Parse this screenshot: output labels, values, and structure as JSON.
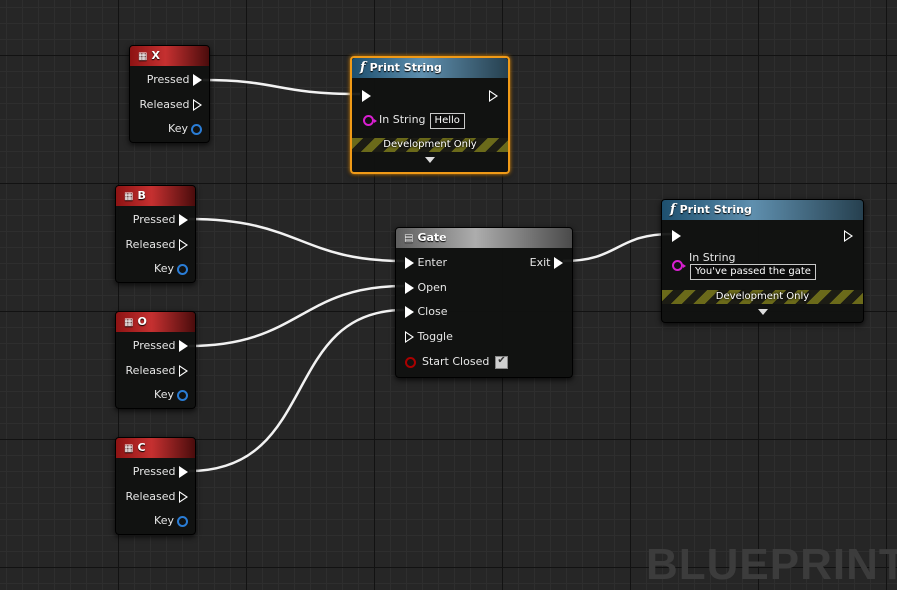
{
  "input_nodes": [
    {
      "key": "X",
      "pins": [
        "Pressed",
        "Released",
        "Key"
      ]
    },
    {
      "key": "B",
      "pins": [
        "Pressed",
        "Released",
        "Key"
      ]
    },
    {
      "key": "O",
      "pins": [
        "Pressed",
        "Released",
        "Key"
      ]
    },
    {
      "key": "C",
      "pins": [
        "Pressed",
        "Released",
        "Key"
      ]
    }
  ],
  "print1": {
    "title": "Print String",
    "in_label": "In String",
    "value": "Hello",
    "dev": "Development Only"
  },
  "gate": {
    "title": "Gate",
    "enter": "Enter",
    "open": "Open",
    "close": "Close",
    "toggle": "Toggle",
    "start_closed": "Start Closed",
    "exit": "Exit"
  },
  "print2": {
    "title": "Print String",
    "in_label": "In String",
    "value": "You've passed the gate",
    "dev": "Development Only"
  },
  "watermark": "BLUEPRINT",
  "colors": {
    "selection": "#f09a17",
    "input_header": "#c53030",
    "func_header": "#5f8fae",
    "string_pin": "#d91fd1",
    "key_pin": "#2a7dd6",
    "bool_pin": "#aa0000"
  }
}
